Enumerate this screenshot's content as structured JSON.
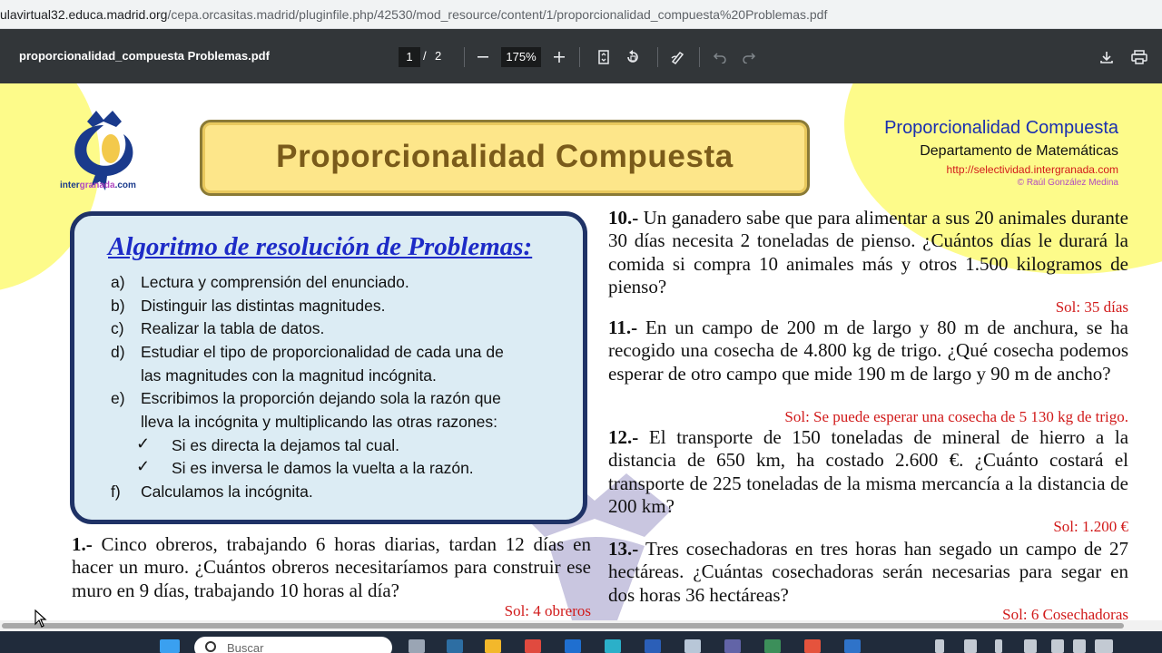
{
  "browser": {
    "url_host": "ulavirtual32.educa.madrid.org",
    "url_path": "/cepa.orcasitas.madrid/pluginfile.php/42530/mod_resource/content/1/proporcionalidad_compuesta%20Problemas.pdf"
  },
  "viewer": {
    "filename": "proporcionalidad_compuesta Problemas.pdf",
    "current_page": "1",
    "page_separator": "/",
    "total_pages": "2",
    "zoom": "175%"
  },
  "document": {
    "logo_text_1": "inter",
    "logo_text_2": "granada",
    "logo_text_3": ".com",
    "banner_title": "Proporcionalidad Compuesta",
    "header_title": "Proporcionalidad Compuesta",
    "header_dept": "Departamento de Matemáticas",
    "header_url": "http://selectividad.intergranada.com",
    "header_author": "© Raúl González Medina",
    "algorithm": {
      "title": "Algoritmo de resolución de Problemas:",
      "steps": [
        {
          "letter": "a)",
          "text": "Lectura y comprensión del enunciado."
        },
        {
          "letter": "b)",
          "text": "Distinguir las distintas magnitudes."
        },
        {
          "letter": "c)",
          "text": "Realizar la tabla de datos."
        },
        {
          "letter": "d)",
          "text": "Estudiar el tipo de proporcionalidad de cada una de",
          "cont": "las magnitudes con la magnitud incógnita."
        },
        {
          "letter": "e)",
          "text": "Escribimos la proporción dejando sola la razón que",
          "cont": "lleva la incógnita y multiplicando las otras razones:"
        },
        {
          "letter": "f)",
          "text": "Calculamos la incógnita."
        }
      ],
      "check_mark": "✓",
      "sub_steps": [
        "Si es directa la dejamos tal cual.",
        "Si es inversa le damos la vuelta a la razón."
      ]
    },
    "problems": [
      {
        "num": "1.-",
        "text": "Cinco obreros, trabajando 6 horas diarias, tardan 12 días en hacer un muro. ¿Cuántos obreros necesitaríamos para construir ese muro en 9 días, trabajando 10 horas al día?",
        "sol": "Sol: 4 obreros"
      },
      {
        "num": "10.-",
        "text": "Un ganadero sabe que para alimentar a sus 20 animales durante 30 días necesita 2 toneladas de pienso. ¿Cuántos días le durará la comida si compra 10 animales más y otros 1.500 kilogramos de pienso?",
        "sol": "Sol: 35 días"
      },
      {
        "num": "11.-",
        "text": "En un campo de 200 m de largo y 80 m de anchura, se ha recogido una cosecha de 4.800 kg de trigo. ¿Qué cosecha podemos esperar de otro campo que mide 190 m de largo y 90 m de ancho?",
        "sol": "Sol: Se puede esperar una cosecha de 5 130 kg de trigo."
      },
      {
        "num": "12.-",
        "text": "El transporte de 150 toneladas de mineral de hierro a la distancia de 650 km, ha costado 2.600 €. ¿Cuánto costará el transporte de 225 toneladas de la misma mercancía a la distancia de 200 km?",
        "sol": "Sol: 1.200 €"
      },
      {
        "num": "13.-",
        "text": "Tres cosechadoras en tres horas han segado un campo de 27 hectáreas. ¿Cuántas cosechadoras serán necesarias para segar en dos horas 36 hectáreas?",
        "sol": "Sol: 6 Cosechadoras"
      }
    ]
  },
  "taskbar": {
    "search_placeholder": "Buscar"
  }
}
